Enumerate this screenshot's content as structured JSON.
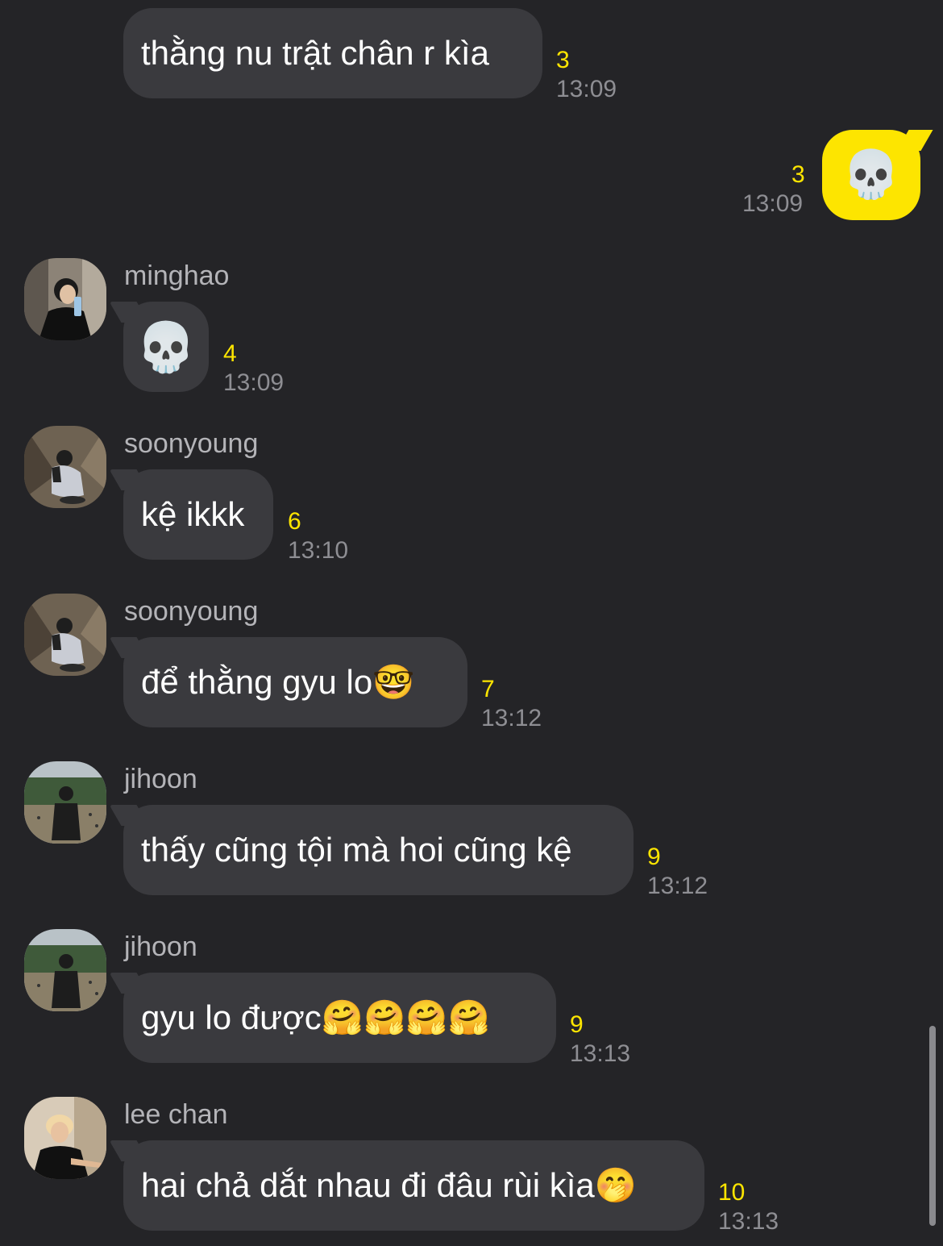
{
  "colors": {
    "background": "#242427",
    "bubble_other": "#3a3a3e",
    "bubble_mine": "#fde500",
    "unread": "#fde500",
    "time": "#8e8e93"
  },
  "messages": [
    {
      "type": "other_continued",
      "text": "thằng nu trật chân r kìa",
      "unread": "3",
      "time": "13:09"
    },
    {
      "type": "mine",
      "text": "💀",
      "unread": "3",
      "time": "13:09"
    },
    {
      "type": "other",
      "sender": "minghao",
      "avatar_icon": "avatar-photo-icon",
      "text": "💀",
      "unread": "4",
      "time": "13:09"
    },
    {
      "type": "other",
      "sender": "soonyoung",
      "avatar_icon": "avatar-photo-icon",
      "text": "kệ ikkk",
      "unread": "6",
      "time": "13:10"
    },
    {
      "type": "other",
      "sender": "soonyoung",
      "avatar_icon": "avatar-photo-icon",
      "text": "để thằng gyu lo🤓",
      "unread": "7",
      "time": "13:12"
    },
    {
      "type": "other",
      "sender": "jihoon",
      "avatar_icon": "avatar-photo-icon",
      "text": "thấy cũng tội mà hoi cũng kệ",
      "unread": "9",
      "time": "13:12"
    },
    {
      "type": "other",
      "sender": "jihoon",
      "avatar_icon": "avatar-photo-icon",
      "text": "gyu lo được🤗🤗🤗🤗",
      "unread": "9",
      "time": "13:13"
    },
    {
      "type": "other",
      "sender": "lee chan",
      "avatar_icon": "avatar-photo-icon",
      "text": "hai chả dắt nhau đi đâu rùi kìa🤭",
      "unread": "10",
      "time": "13:13"
    }
  ]
}
